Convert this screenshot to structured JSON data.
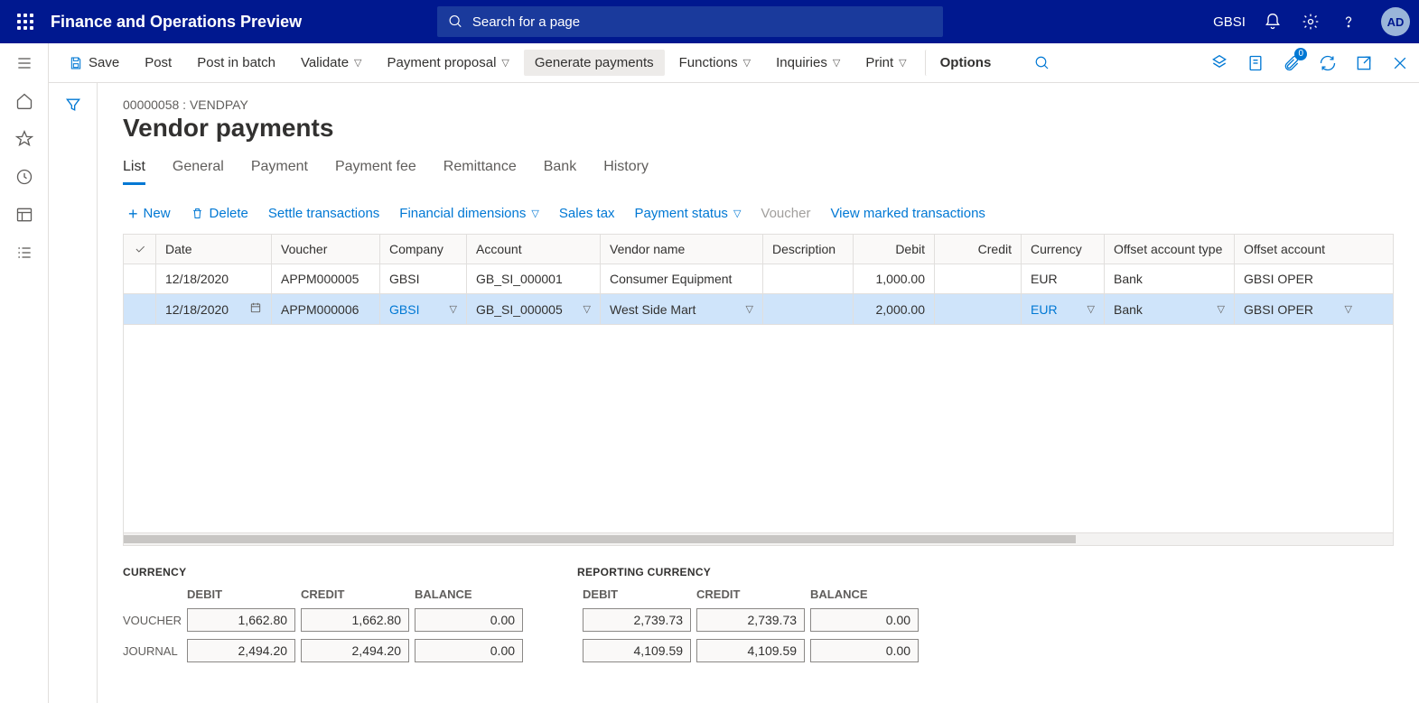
{
  "topnav": {
    "app_name": "Finance and Operations Preview",
    "search_placeholder": "Search for a page",
    "company": "GBSI",
    "avatar_initials": "AD"
  },
  "actionbar": {
    "save": "Save",
    "post": "Post",
    "post_batch": "Post in batch",
    "validate": "Validate",
    "payment_proposal": "Payment proposal",
    "generate_payments": "Generate payments",
    "functions": "Functions",
    "inquiries": "Inquiries",
    "print": "Print",
    "options": "Options",
    "attach_count": "0"
  },
  "page": {
    "breadcrumb": "00000058 : VENDPAY",
    "title": "Vendor payments"
  },
  "tabs": [
    "List",
    "General",
    "Payment",
    "Payment fee",
    "Remittance",
    "Bank",
    "History"
  ],
  "commands": {
    "new": "New",
    "delete": "Delete",
    "settle": "Settle transactions",
    "financial_dim": "Financial dimensions",
    "sales_tax": "Sales tax",
    "payment_status": "Payment status",
    "voucher": "Voucher",
    "view_marked": "View marked transactions"
  },
  "table": {
    "headers": {
      "date": "Date",
      "voucher": "Voucher",
      "company": "Company",
      "account": "Account",
      "vendor_name": "Vendor name",
      "description": "Description",
      "debit": "Debit",
      "credit": "Credit",
      "currency": "Currency",
      "offset_type": "Offset account type",
      "offset_account": "Offset account"
    },
    "rows": [
      {
        "date": "12/18/2020",
        "voucher": "APPM000005",
        "company": "GBSI",
        "account": "GB_SI_000001",
        "vendor_name": "Consumer Equipment",
        "description": "",
        "debit": "1,000.00",
        "credit": "",
        "currency": "EUR",
        "offset_type": "Bank",
        "offset_account": "GBSI OPER"
      },
      {
        "date": "12/18/2020",
        "voucher": "APPM000006",
        "company": "GBSI",
        "account": "GB_SI_000005",
        "vendor_name": "West Side Mart",
        "description": "",
        "debit": "2,000.00",
        "credit": "",
        "currency": "EUR",
        "offset_type": "Bank",
        "offset_account": "GBSI OPER"
      }
    ]
  },
  "totals": {
    "currency": {
      "title": "CURRENCY",
      "cols": {
        "debit": "DEBIT",
        "credit": "CREDIT",
        "balance": "BALANCE"
      },
      "voucher_label": "VOUCHER",
      "journal_label": "JOURNAL",
      "voucher": {
        "debit": "1,662.80",
        "credit": "1,662.80",
        "balance": "0.00"
      },
      "journal": {
        "debit": "2,494.20",
        "credit": "2,494.20",
        "balance": "0.00"
      }
    },
    "reporting": {
      "title": "REPORTING CURRENCY",
      "cols": {
        "debit": "DEBIT",
        "credit": "CREDIT",
        "balance": "BALANCE"
      },
      "voucher": {
        "debit": "2,739.73",
        "credit": "2,739.73",
        "balance": "0.00"
      },
      "journal": {
        "debit": "4,109.59",
        "credit": "4,109.59",
        "balance": "0.00"
      }
    }
  }
}
